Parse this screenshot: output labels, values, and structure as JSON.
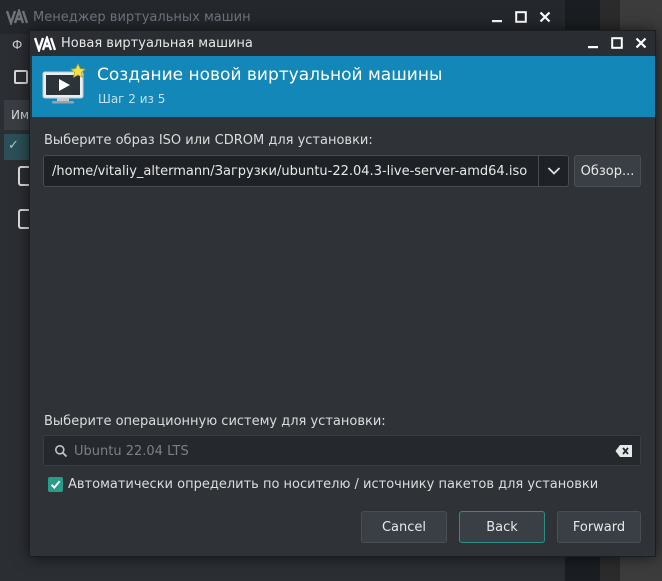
{
  "background_window": {
    "title": "Менеджер виртуальных машин",
    "menu_fragment": "Ф",
    "list_header_fragment": "Им",
    "tree_glyph": "✓"
  },
  "dialog": {
    "title": "Новая виртуальная машина",
    "banner": {
      "title": "Создание новой виртуальной машины",
      "step": "Шаг 2 из 5"
    },
    "iso_label": "Выберите образ ISO или CDROM для установки:",
    "iso_value": "/home/vitaliy_altermann/Загрузки/ubuntu-22.04.3-live-server-amd64.iso",
    "browse_label": "Обзор...",
    "os_label": "Выберите операционную систему для установки:",
    "os_search_placeholder": "Ubuntu 22.04 LTS",
    "auto_detect_label": "Автоматически определить по носителю / источнику пакетов для установки",
    "auto_detect_checked": true,
    "buttons": {
      "cancel": "Cancel",
      "back": "Back",
      "forward": "Forward"
    }
  },
  "colors": {
    "banner": "#1387b8",
    "accent": "#2a9d8a",
    "dialog_bg": "#2f3338"
  }
}
